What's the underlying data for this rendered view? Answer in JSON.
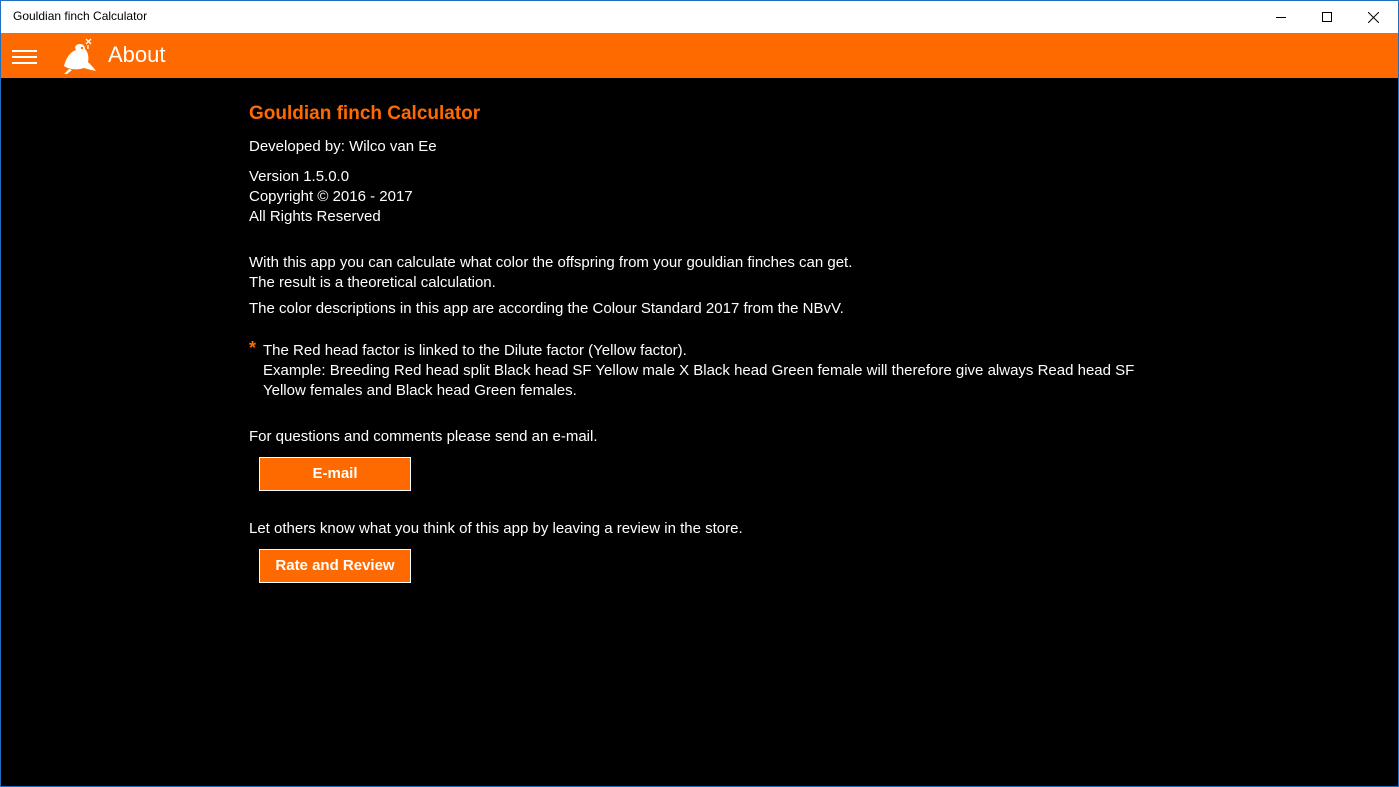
{
  "window": {
    "title": "Gouldian finch Calculator"
  },
  "appbar": {
    "page_title": "About",
    "menu_icon": "hamburger-menu-icon",
    "logo_icon": "gouldian-finch-logo-icon",
    "accent_color": "#ff6a00"
  },
  "about": {
    "app_name": "Gouldian finch Calculator",
    "developer": "Developed by: Wilco van Ee",
    "version": "Version 1.5.0.0",
    "copyright": "Copyright © 2016 - 2017",
    "rights": "All Rights Reserved",
    "description_1": "With this app you can calculate what color the offspring from your gouldian finches can get.",
    "description_2": "The result is a theoretical calculation.",
    "description_3": "The color descriptions in this app are according the Colour Standard 2017 from the NBvV.",
    "note_marker": "*",
    "note_line_1": "The Red head factor is linked to the Dilute factor (Yellow factor).",
    "note_line_2": "Example: Breeding Red head split Black head SF Yellow male X Black head Green female will therefore give always Read head SF Yellow females and Black head Green females.",
    "email_prompt": "For questions and comments please send an e-mail.",
    "email_button": "E-mail",
    "review_prompt": "Let others know what you think of this app by leaving a review in the store.",
    "review_button": "Rate and Review"
  }
}
